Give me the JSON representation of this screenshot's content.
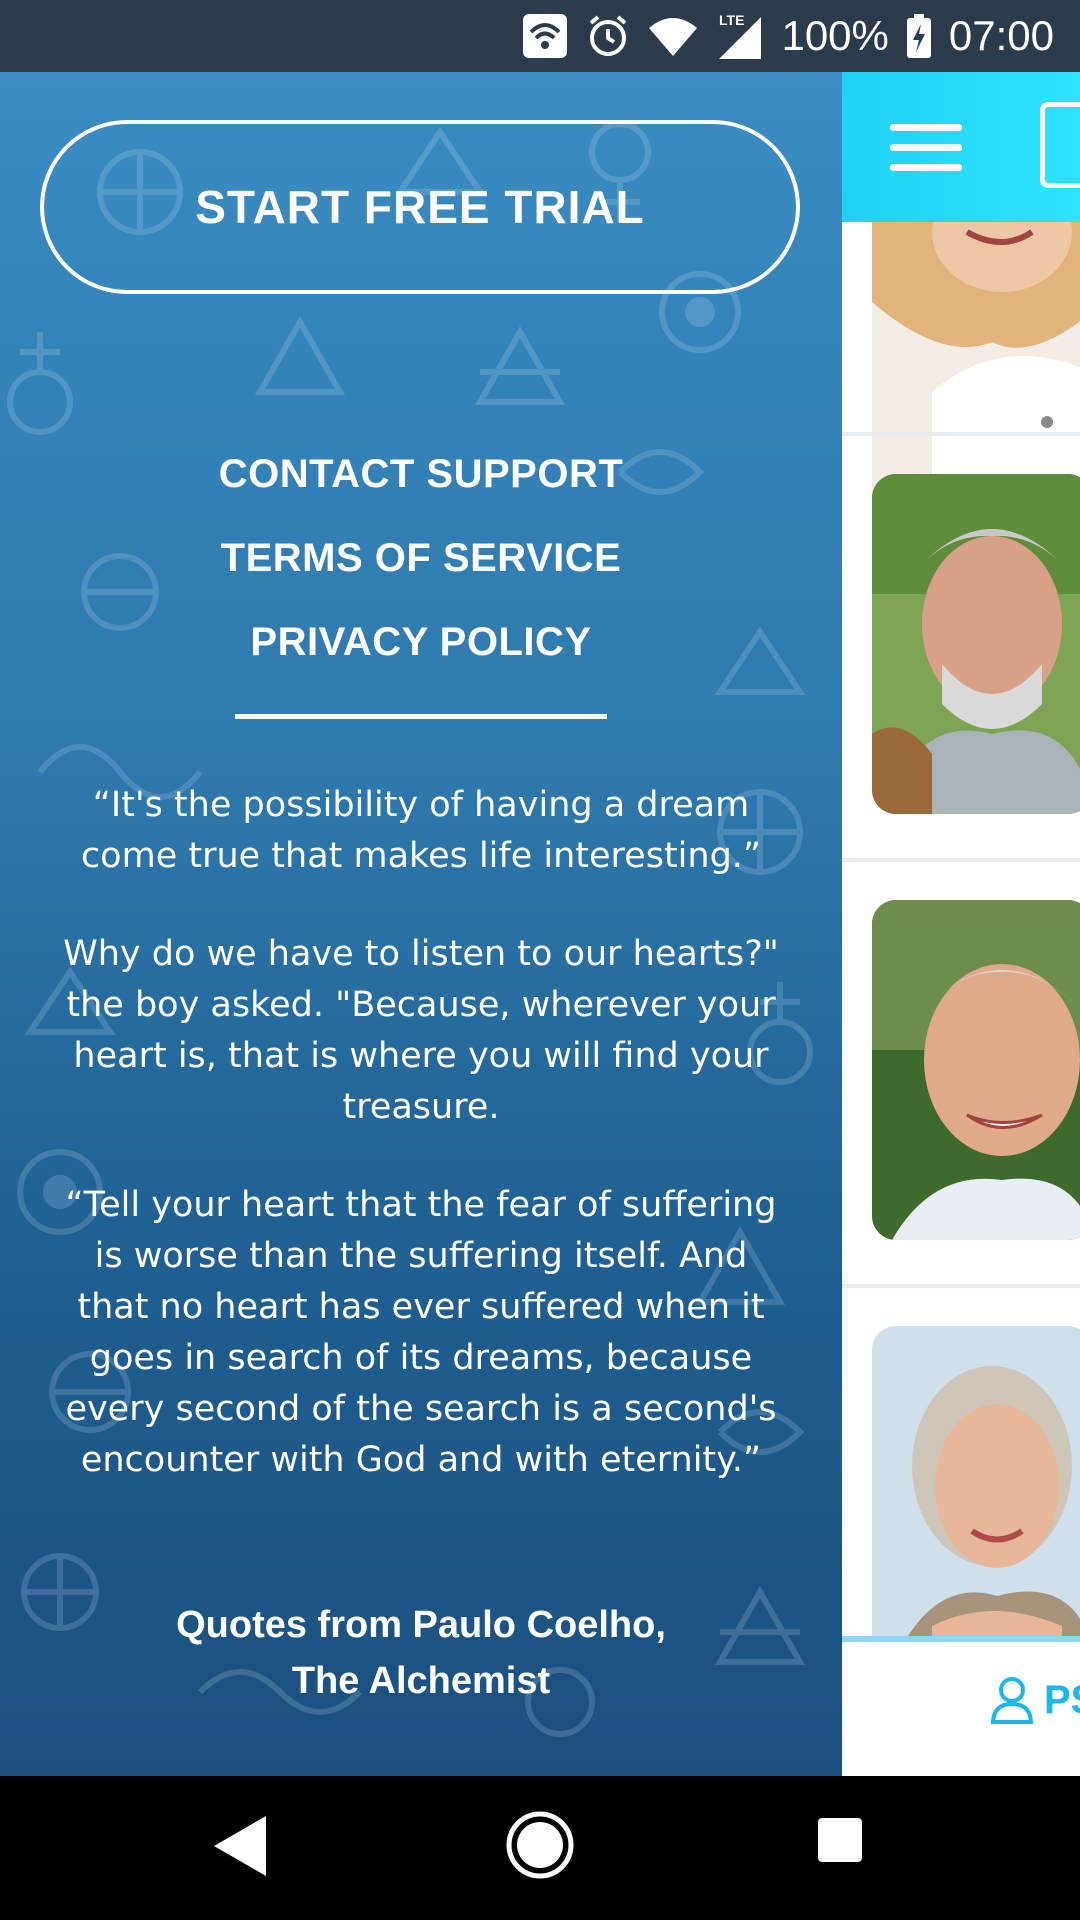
{
  "status_bar": {
    "battery": "100%",
    "time": "07:00",
    "network": "LTE",
    "icons": [
      "wifi-calling-icon",
      "alarm-icon",
      "wifi-icon",
      "signal-icon",
      "battery-charging-icon"
    ]
  },
  "drawer": {
    "trial_button": "START FREE TRIAL",
    "links": [
      {
        "label": "CONTACT SUPPORT"
      },
      {
        "label": "TERMS OF SERVICE"
      },
      {
        "label": "PRIVACY POLICY"
      }
    ],
    "quotes": [
      "“It's the possibility of having a dream come true that makes life interesting.”",
      "Why do we have to listen to our hearts?\" the boy asked. \"Because, wherever your heart is, that is where you will find your treasure.",
      "“Tell your heart that the fear of suffering is worse than the suffering itself. And that no heart has ever suffered when it goes in search of its dreams, because every second of the search is a second's encounter with God and with eternity.”"
    ],
    "attribution_line1": "Quotes from Paulo Coelho,",
    "attribution_line2": "The Alchemist"
  },
  "app": {
    "tab_label": "PS",
    "header_icons": [
      "menu-icon",
      "cards-icon"
    ],
    "colors": {
      "header": "#2ee3ff",
      "accent": "#1ab8ea"
    }
  },
  "colors": {
    "drawer_top": "#3a8cc2",
    "drawer_bottom": "#1b4f7e"
  }
}
